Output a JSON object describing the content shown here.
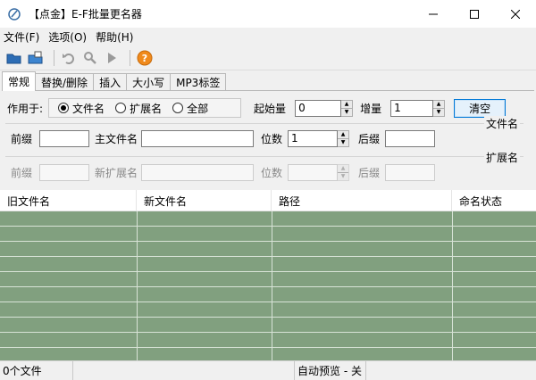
{
  "window": {
    "title": "【点金】E-F批量更名器",
    "controls": [
      "minimize-icon",
      "maximize-icon",
      "close-icon"
    ]
  },
  "menu": {
    "items": [
      "文件(F)",
      "选项(O)",
      "帮助(H)"
    ]
  },
  "toolbar": {
    "icons": [
      "open-folder-icon",
      "open-files-icon",
      "undo-icon",
      "search-icon",
      "play-icon",
      "help-icon"
    ]
  },
  "tabs": [
    "常规",
    "替换/删除",
    "插入",
    "大小写",
    "MP3标签"
  ],
  "general": {
    "apply_label": "作用于:",
    "radios": [
      {
        "label": "文件名",
        "selected": true
      },
      {
        "label": "扩展名",
        "selected": false
      },
      {
        "label": "全部",
        "selected": false
      }
    ],
    "start_label": "起始量",
    "start_value": "0",
    "increment_label": "增量",
    "increment_value": "1",
    "clear_label": "清空"
  },
  "filename_group": {
    "title": "文件名",
    "prefix_label": "前缀",
    "prefix_value": "",
    "main_label": "主文件名",
    "main_value": "",
    "digits_label": "位数",
    "digits_value": "1",
    "suffix_label": "后缀",
    "suffix_value": ""
  },
  "extension_group": {
    "title": "扩展名",
    "prefix_label": "前缀",
    "prefix_value": "",
    "new_ext_label": "新扩展名",
    "new_ext_value": "",
    "digits_label": "位数",
    "digits_value": "",
    "suffix_label": "后缀",
    "suffix_value": ""
  },
  "list": {
    "columns": [
      "旧文件名",
      "新文件名",
      "路径",
      "命名状态"
    ],
    "background": "#81a07f"
  },
  "status": {
    "file_count": "0个文件",
    "preview": "自动预览 - 关"
  }
}
